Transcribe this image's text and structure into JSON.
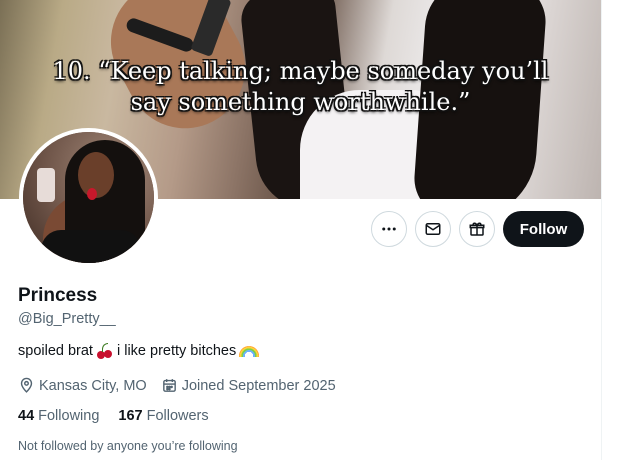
{
  "banner": {
    "quote_line1": "10. “Keep talking; maybe someday you’ll",
    "quote_line2": "say something worthwhile.”"
  },
  "actions": {
    "more_icon": "more-horizontal-icon",
    "message_icon": "envelope-icon",
    "gift_icon": "gift-icon",
    "follow_label": "Follow"
  },
  "profile": {
    "name": "Princess",
    "handle": "@Big_Pretty__",
    "bio_part1": "spoiled brat",
    "bio_emoji1": "cherries",
    "bio_part2": "i like pretty bitches",
    "bio_emoji2": "rainbow",
    "location": "Kansas City, MO",
    "joined": "Joined September 2025",
    "following_count": "44",
    "following_label": "Following",
    "followers_count": "167",
    "followers_label": "Followers",
    "not_followed_text": "Not followed by anyone you’re following"
  },
  "colors": {
    "text_primary": "#0f1419",
    "text_secondary": "#536471",
    "button_dark": "#0f1419",
    "border": "#cfd9de"
  }
}
